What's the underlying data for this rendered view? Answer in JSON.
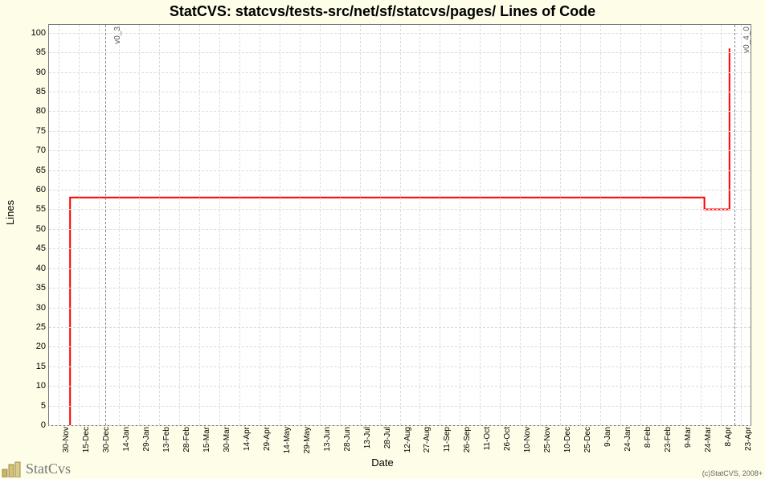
{
  "title": "StatCVS: statcvs/tests-src/net/sf/statcvs/pages/ Lines of Code",
  "xlabel": "Date",
  "ylabel": "Lines",
  "footer_logo_text": "StatCvs",
  "copyright": "(c)StatCVS, 2008+",
  "chart_data": {
    "type": "line",
    "xlabel": "Date",
    "ylabel": "Lines",
    "title": "StatCVS: statcvs/tests-src/net/sf/statcvs/pages/ Lines of Code",
    "ylim": [
      0,
      102
    ],
    "y_ticks": [
      0,
      5,
      10,
      15,
      20,
      25,
      30,
      35,
      40,
      45,
      50,
      55,
      60,
      65,
      70,
      75,
      80,
      85,
      90,
      95,
      100
    ],
    "x_categories": [
      "30-Nov",
      "15-Dec",
      "30-Dec",
      "14-Jan",
      "29-Jan",
      "13-Feb",
      "28-Feb",
      "15-Mar",
      "30-Mar",
      "14-Apr",
      "29-Apr",
      "14-May",
      "29-May",
      "13-Jun",
      "28-Jun",
      "13-Jul",
      "28-Jul",
      "12-Aug",
      "27-Aug",
      "11-Sep",
      "26-Sep",
      "11-Oct",
      "26-Oct",
      "10-Nov",
      "25-Nov",
      "10-Dec",
      "25-Dec",
      "9-Jan",
      "24-Jan",
      "8-Feb",
      "23-Feb",
      "9-Mar",
      "24-Mar",
      "8-Apr",
      "23-Apr"
    ],
    "markers": [
      {
        "label": "v0_3",
        "x_index_approx": 2.3
      },
      {
        "label": "v0_4_0",
        "x_index_approx": 33.7
      }
    ],
    "series": [
      {
        "name": "Lines of Code",
        "color": "#ff0000",
        "points": [
          {
            "x_index": 0.55,
            "y": 0
          },
          {
            "x_index": 0.55,
            "y": 58
          },
          {
            "x_index": 32.2,
            "y": 58
          },
          {
            "x_index": 32.2,
            "y": 55
          },
          {
            "x_index": 33.45,
            "y": 55
          },
          {
            "x_index": 33.45,
            "y": 96
          }
        ]
      }
    ]
  }
}
